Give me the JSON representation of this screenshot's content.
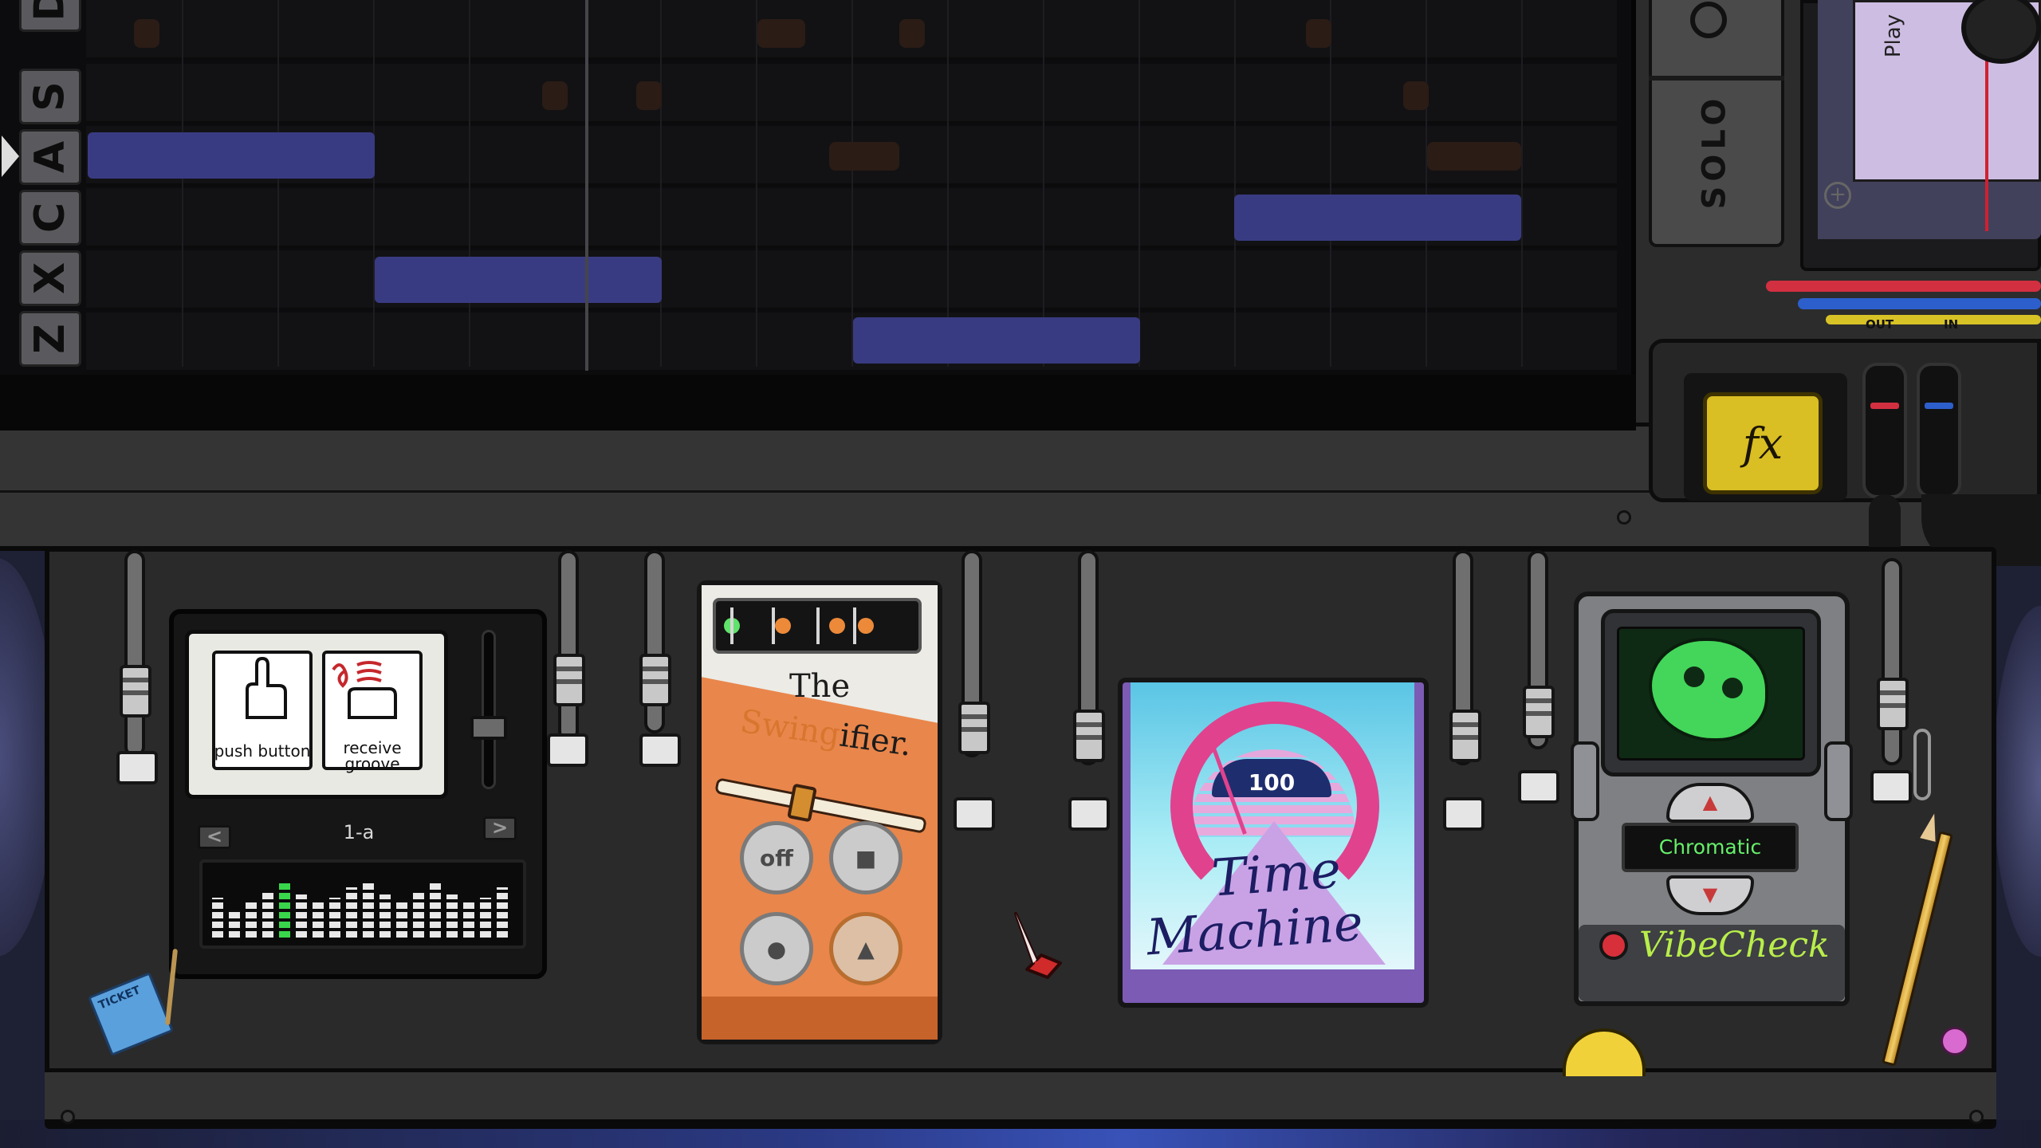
{
  "piano_roll": {
    "keys": [
      "D",
      "S",
      "A",
      "C",
      "X",
      "Z"
    ],
    "active_key": "A",
    "notes": [
      {
        "key": "A",
        "start": 0,
        "length": 3
      },
      {
        "key": "X",
        "start": 3,
        "length": 3
      },
      {
        "key": "Z",
        "start": 8,
        "length": 3
      },
      {
        "key": "C",
        "start": 12,
        "length": 3
      }
    ]
  },
  "top_right": {
    "solo_label": "SOLO",
    "cassette_label": "Play",
    "port_out_label": "OUT",
    "port_in_label": "IN",
    "fx_button_label": "fx"
  },
  "pedals": {
    "looper": {
      "push_button_label": "push button",
      "receive_groove_label": "receive groove",
      "prev_label": "<",
      "next_label": ">",
      "track_name": "1-a",
      "meter_levels": [
        0.55,
        0.4,
        0.5,
        0.65,
        0.75,
        0.6,
        0.5,
        0.55,
        0.7,
        0.8,
        0.6,
        0.5,
        0.65,
        0.75,
        0.6,
        0.5,
        0.55,
        0.7
      ],
      "active_meter_index": 4
    },
    "swingifier": {
      "title_the": "The",
      "title_swing": "Swing",
      "title_rest": "ifier.",
      "off_label": "off",
      "stop_symbol": "■",
      "record_symbol": "●",
      "play_symbol": "▲",
      "swing_amount": 0.45
    },
    "time_machine": {
      "gauge_value": "100",
      "title_line_1": "Time",
      "title_line_2": "Machine"
    },
    "vibe_check": {
      "mode_label": "Chromatic",
      "brand": "VibeCheck",
      "up_symbol": "▲",
      "down_symbol": "▼"
    }
  },
  "props": {
    "ticket_text": "TICKET"
  },
  "colors": {
    "note": "#393b82",
    "swing_accent": "#d8752e",
    "time_pink": "#e0428e",
    "vibe_green": "#66f06a",
    "fx_yellow": "#d9be24"
  }
}
